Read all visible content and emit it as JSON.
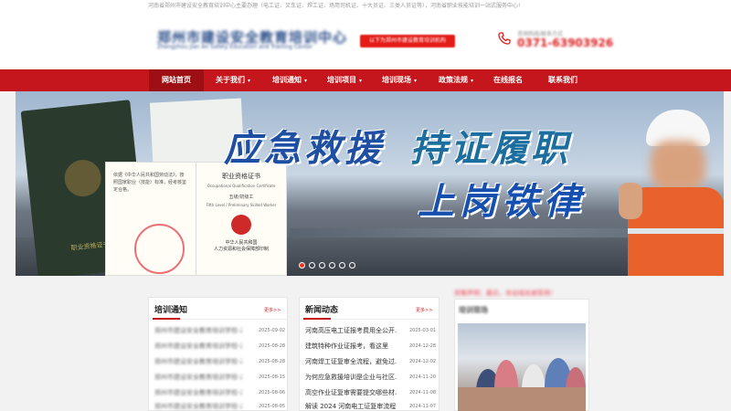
{
  "topbar": {
    "text": "河南省郑州市建设安全教育培训中心主要办理（电工证、叉车证、焊工证、场用司机证、十大员证、三类人员证等），河南省职业技能培训一站式服务中心!"
  },
  "header": {
    "logo_cn": "郑州市建设安全教育培训中心",
    "logo_en": "Zhengzhou Jian An Safety Education and Training Center",
    "slogan": "以下为郑州市建设教育培训机构",
    "phone_label": "咨询热线/联系方式",
    "phone": "0371-63903926"
  },
  "nav": [
    {
      "label": "网站首页",
      "caret": false,
      "active": true
    },
    {
      "label": "关于我们",
      "caret": true
    },
    {
      "label": "培训通知",
      "caret": true
    },
    {
      "label": "培训项目",
      "caret": true
    },
    {
      "label": "培训现场",
      "caret": true
    },
    {
      "label": "政策法规",
      "caret": true
    },
    {
      "label": "在线报名",
      "caret": false
    },
    {
      "label": "联系我们",
      "caret": false
    }
  ],
  "banner": {
    "headline_a": "应急救援",
    "headline_b": "持证履职",
    "subhead": "上岗铁律",
    "cert_title": "职业资格证书",
    "cert_en": "Occupational Qualification Certificate",
    "cert_level": "五级/初级工",
    "cert_level_en": "Fifth Level / Preliminary Skilled Worker",
    "cert_issuer_1": "中华人民共和国",
    "cert_issuer_2": "人力资源和社会保障部印制",
    "cert_left_text": "依据《中华人民共和国劳动法》，按照国家职业（技能）标准，经考核鉴定合格。",
    "book_title": "职业资格证书",
    "dots": 6,
    "active_dot": 0
  },
  "training": {
    "title": "培训通知",
    "more": "更多>>",
    "items": [
      {
        "title": "郑州市建设安全教育培训学校-2025年...",
        "date": "2025-09-02"
      },
      {
        "title": "郑州市建设安全教育培训学校-2025年...",
        "date": "2025-08-28"
      },
      {
        "title": "郑州市建设安全教育培训学校-2025年...",
        "date": "2025-08-28"
      },
      {
        "title": "郑州市建设安全教育培训学校-2025年...",
        "date": "2025-08-15"
      },
      {
        "title": "郑州市建设安全教育培训学校-2025年...",
        "date": "2025-08-06"
      },
      {
        "title": "郑州市建设安全教育培训学校-2025年...",
        "date": "2025-08-05"
      }
    ]
  },
  "news": {
    "title": "新闻动态",
    "more": "更多>>",
    "items": [
      {
        "title": "河南高压电工证报考费用全公开...",
        "date": "2025-03-01"
      },
      {
        "title": "建筑特种作业证报考，看这里",
        "date": "2024-12-28"
      },
      {
        "title": "河南焊工证复审全流程，避免过...",
        "date": "2024-12-02"
      },
      {
        "title": "为何应急救援培训是企业与社区...",
        "date": "2024-11-20"
      },
      {
        "title": "高空作业证复审需要提交哪些材...",
        "date": "2024-11-08"
      },
      {
        "title": "解读 2024 河南电工证复审流程...",
        "date": "2024-11-07"
      }
    ]
  },
  "side": {
    "notice": "郑重声明：最近，本站域名被冒用！",
    "photo_title": "培训现场"
  }
}
